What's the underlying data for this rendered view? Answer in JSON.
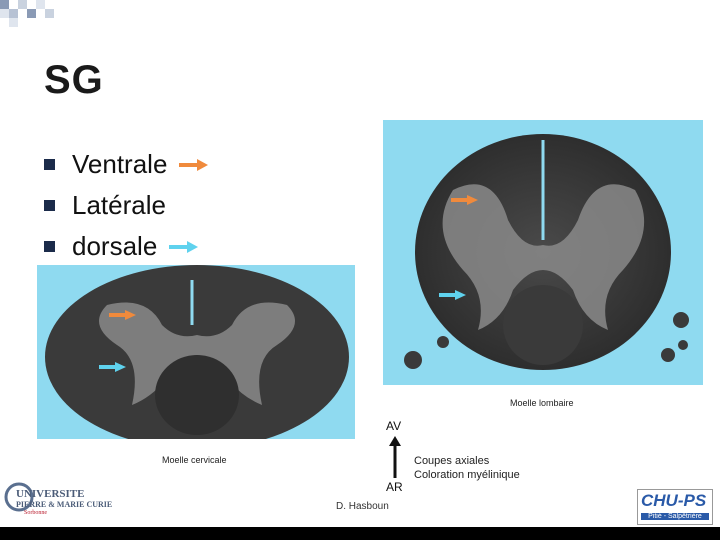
{
  "slide": {
    "title": "SG",
    "bullets": [
      {
        "label": "Ventrale",
        "arrow_color": "#f08a3c"
      },
      {
        "label": "Latérale",
        "arrow_color": null
      },
      {
        "label": "dorsale",
        "arrow_color": "#5fd2ee"
      }
    ]
  },
  "figures": {
    "lumbar_caption": "Moelle lombaire",
    "cervical_caption": "Moelle cervicale",
    "orientation_top": "AV",
    "orientation_bottom": "AR",
    "legend_line1": "Coupes axiales",
    "legend_line2": "Coloration myélinique",
    "background_color": "#8fdaf0",
    "ventral_arrow_color": "#f08a3c",
    "dorsal_arrow_color": "#5fd2ee"
  },
  "footer": {
    "author": "D. Hasboun",
    "left_logo_line1": "UNIVERSITE",
    "left_logo_line2": "PIERRE & MARIE CURIE",
    "left_logo_tagline": "Sorbonne",
    "right_logo_text": "CHU-PS",
    "right_logo_sub": "Pitié - Salpêtrière"
  }
}
